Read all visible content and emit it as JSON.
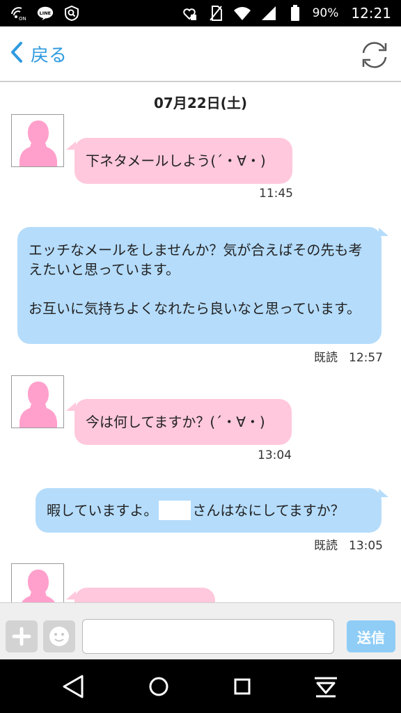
{
  "status_bar": {
    "icons": [
      "wifi-on-icon",
      "line-icon",
      "shield-search-icon",
      "heart-battery-icon",
      "no-sim-icon",
      "wifi-icon",
      "signal-icon",
      "battery-icon"
    ],
    "battery": "90%",
    "time": "12:21"
  },
  "header": {
    "back_label": "戻る",
    "refresh_icon": "refresh-icon",
    "accent": "#2f9be0"
  },
  "chat": {
    "date": "07月22日(土)",
    "messages": [
      {
        "direction": "in",
        "text": "下ネタメールしよう(´・∀・)",
        "time": "11:45"
      },
      {
        "direction": "out",
        "paragraphs": [
          "エッチなメールをしませんか？気が合えばその先も考えたいと思っています。",
          "お互いに気持ちよくなれたら良いなと思っています。"
        ],
        "read": "既読",
        "time": "12:57"
      },
      {
        "direction": "in",
        "text": "今は何してますか？(´・∀・)",
        "time": "13:04"
      },
      {
        "direction": "out",
        "text_before": "暇していますよ。",
        "text_after": "さんはなにしてますか？",
        "read": "既読",
        "time": "13:05"
      },
      {
        "direction": "in",
        "text": ""
      }
    ],
    "incoming_color": "#ffc8dc",
    "outgoing_color": "#b5dcfb"
  },
  "input_bar": {
    "placeholder": "",
    "send_label": "送信",
    "send_color": "#8fcdf7"
  },
  "nav_bar": {
    "icons": [
      "back-triangle-icon",
      "home-circle-icon",
      "recents-square-icon",
      "notification-pull-icon"
    ]
  }
}
